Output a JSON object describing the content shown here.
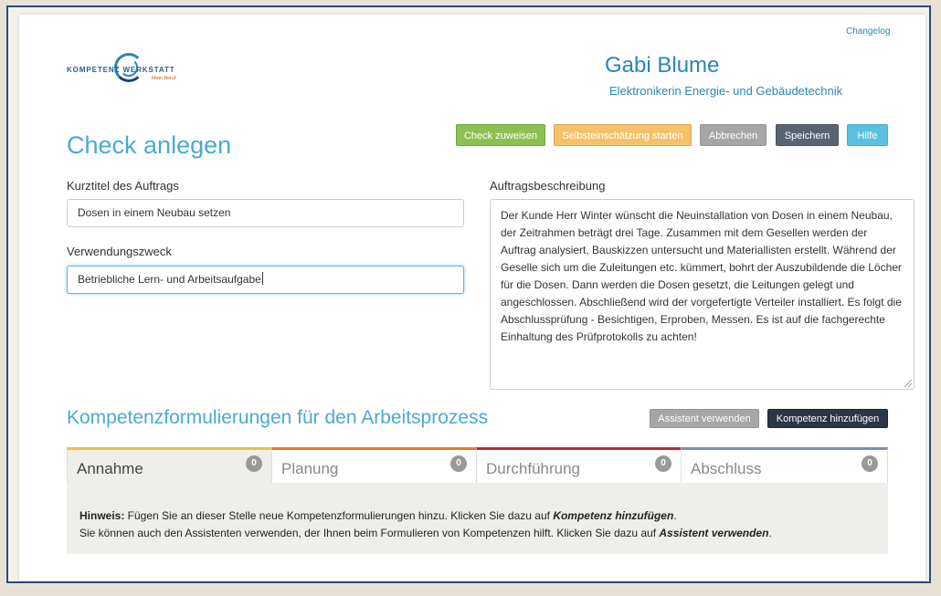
{
  "header": {
    "changelog": "Changelog",
    "logo": {
      "text": "KOMPETENZ WERKSTATT",
      "sub": "Mein Beruf"
    },
    "user_name": "Gabi Blume",
    "user_role": "Elektronikerin Energie- und Gebäudetechnik"
  },
  "page_title": "Check anlegen",
  "toolbar": {
    "assign": "Check zuweisen",
    "self_assessment": "Selbsteinschätzung starten",
    "cancel": "Abbrechen",
    "save": "Speichern",
    "help": "Hilfe"
  },
  "colors": {
    "accent": "#4aaad3",
    "green": "#8cc152",
    "orange": "#f5c26b",
    "gray": "#a6a6a6",
    "dark": "#5a6470",
    "blue": "#5bc0de"
  },
  "form": {
    "short_title_label": "Kurztitel des Auftrags",
    "short_title_value": "Dosen in einem Neubau setzen",
    "purpose_label": "Verwendungszweck",
    "purpose_value": "Betriebliche Lern- und Arbeitsaufgabe",
    "description_label": "Auftragsbeschreibung",
    "description_value": "Der Kunde Herr Winter wünscht die Neuinstallation von Dosen in einem Neubau, der Zeitrahmen beträgt drei Tage. Zusammen mit dem Gesellen werden der Auftrag analysiert, Bauskizzen untersucht und Materiallisten erstellt. Während der Geselle sich um die Zuleitungen etc. kümmert, bohrt der Auszubildende die Löcher für die Dosen. Dann werden die Dosen gesetzt, die Leitungen gelegt und angeschlossen. Abschließend wird der vorgefertigte Verteiler installiert. Es folgt die Abschlussprüfung - Besichtigen, Erproben, Messen. Es ist auf die fachgerechte Einhaltung des Prüfprotokolls zu achten!"
  },
  "competencies": {
    "title": "Kompetenzformulierungen für den Arbeitsprozess",
    "assistant_button": "Assistent verwenden",
    "add_button": "Kompetenz hinzufügen",
    "tabs": [
      {
        "label": "Annahme",
        "count": "0",
        "color": "#f0c040"
      },
      {
        "label": "Planung",
        "count": "0",
        "color": "#e07b2a"
      },
      {
        "label": "Durchführung",
        "count": "0",
        "color": "#c0282d"
      },
      {
        "label": "Abschluss",
        "count": "0",
        "color": "#7b8cc4"
      }
    ],
    "hint": {
      "prefix": "Hinweis:",
      "line1": " Fügen Sie an dieser Stelle neue Kompetenzformulierungen hinzu. Klicken Sie dazu auf ",
      "line1_em": "Kompetenz hinzufügen",
      "line1_end": ".",
      "line2": "Sie können auch den Assistenten verwenden, der Ihnen beim Formulieren von Kompetenzen hilft. Klicken Sie dazu auf ",
      "line2_em": "Assistent verwenden",
      "line2_end": "."
    }
  }
}
